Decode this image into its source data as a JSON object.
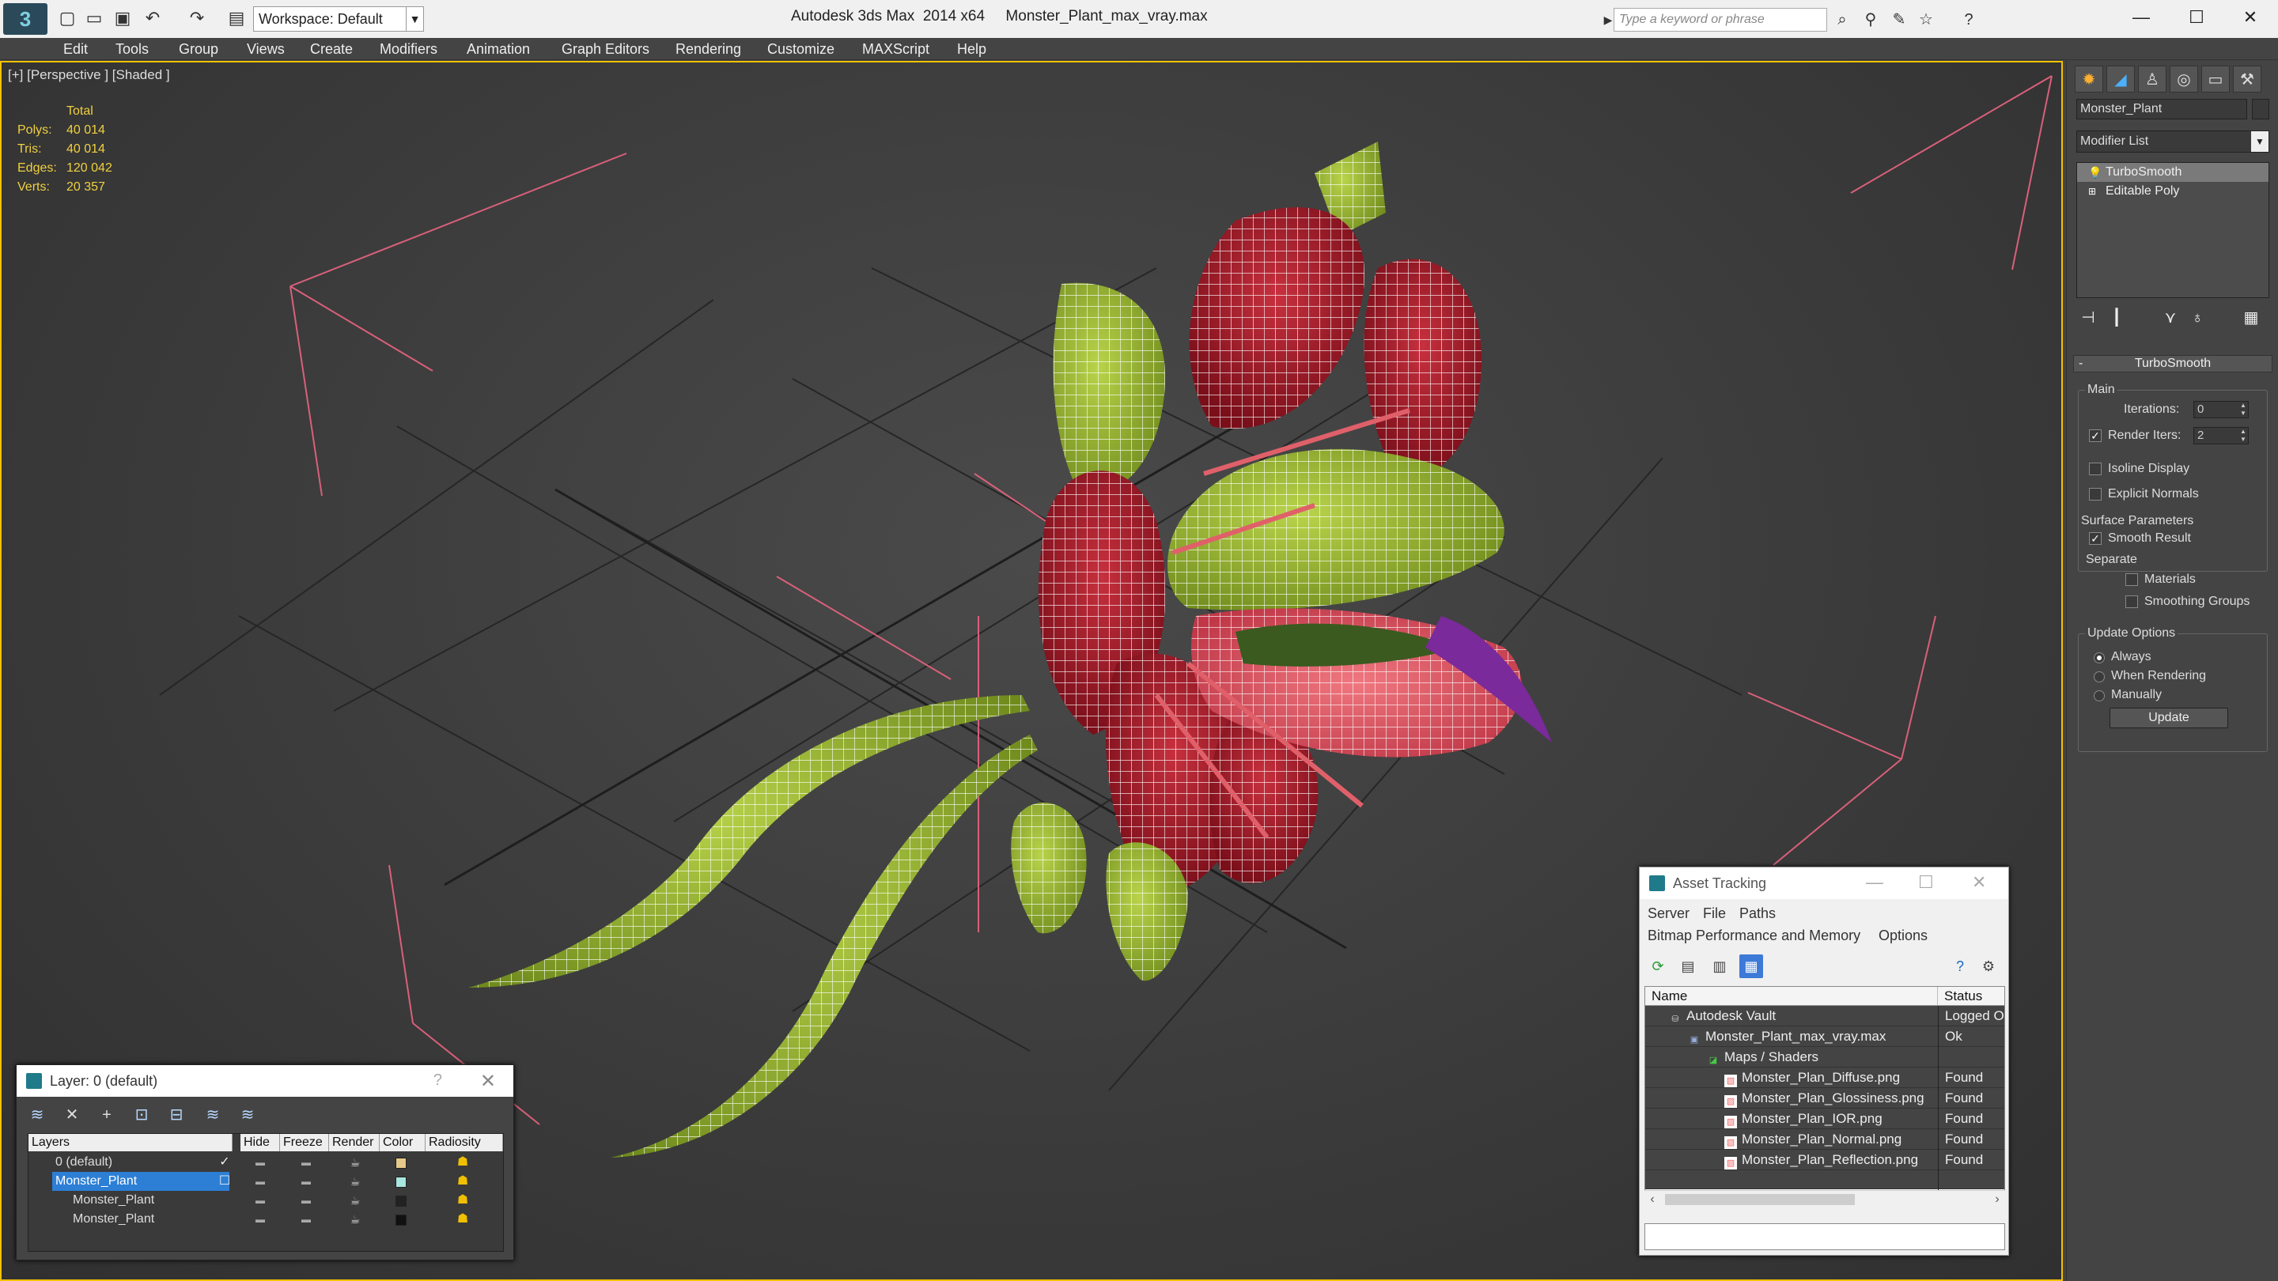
{
  "window": {
    "title": "Autodesk 3ds Max  2014 x64     Monster_Plant_max_vray.max",
    "workspace": "Workspace: Default",
    "search_placeholder": "Type a keyword or phrase"
  },
  "menu": [
    "Edit",
    "Tools",
    "Group",
    "Views",
    "Create",
    "Modifiers",
    "Animation",
    "Graph Editors",
    "Rendering",
    "Customize",
    "MAXScript",
    "Help"
  ],
  "viewport": {
    "label": "[+] [Perspective ] [Shaded ]",
    "stats_header": "Total",
    "stats": [
      {
        "label": "Polys:",
        "value": "40 014"
      },
      {
        "label": "Tris:",
        "value": "40 014"
      },
      {
        "label": "Edges:",
        "value": "120 042"
      },
      {
        "label": "Verts:",
        "value": "20 357"
      }
    ]
  },
  "command_panel": {
    "object_name": "Monster_Plant",
    "modifier_list": "Modifier List",
    "stack": [
      {
        "label": "TurboSmooth",
        "selected": true
      },
      {
        "label": "Editable Poly",
        "selected": false
      }
    ],
    "rollout_title": "TurboSmooth",
    "main_group": "Main",
    "iterations_label": "Iterations:",
    "iterations_value": "0",
    "render_iters_label": "Render Iters:",
    "render_iters_value": "2",
    "render_iters_checked": "✓",
    "isoline_label": "Isoline Display",
    "explicit_normals_label": "Explicit Normals",
    "surface_group": "Surface Parameters",
    "smooth_result_label": "Smooth Result",
    "smooth_result_checked": "✓",
    "separate_label": "Separate",
    "materials_label": "Materials",
    "smoothing_groups_label": "Smoothing Groups",
    "update_group": "Update Options",
    "update_always": "Always",
    "update_rendering": "When Rendering",
    "update_manually": "Manually",
    "update_button": "Update"
  },
  "layer_dialog": {
    "title": "Layer: 0 (default)",
    "help": "?",
    "columns": [
      "Layers",
      "Hide",
      "Freeze",
      "Render",
      "Color",
      "Radiosity"
    ],
    "rows": [
      {
        "name": "0 (default)",
        "check": "✓",
        "color": "#e6c88a"
      },
      {
        "name": "Monster_Plant",
        "check": "",
        "color": "#a8e6e0"
      },
      {
        "name": "Monster_Plant",
        "check": "",
        "color": "#222222"
      },
      {
        "name": "Monster_Plant",
        "check": "",
        "color": "#111111"
      }
    ]
  },
  "asset_dialog": {
    "title": "Asset Tracking",
    "menu_row1": [
      "Server",
      "File",
      "Paths"
    ],
    "menu_row2": [
      "Bitmap Performance and Memory",
      "Options"
    ],
    "columns": [
      "Name",
      "Status"
    ],
    "rows": [
      {
        "name": "Autodesk Vault",
        "status": "Logged O",
        "indent": 0
      },
      {
        "name": "Monster_Plant_max_vray.max",
        "status": "Ok",
        "indent": 1
      },
      {
        "name": "Maps / Shaders",
        "status": "",
        "indent": 2
      },
      {
        "name": "Monster_Plan_Diffuse.png",
        "status": "Found",
        "indent": 3
      },
      {
        "name": "Monster_Plan_Glossiness.png",
        "status": "Found",
        "indent": 3
      },
      {
        "name": "Monster_Plan_IOR.png",
        "status": "Found",
        "indent": 3
      },
      {
        "name": "Monster_Plan_Normal.png",
        "status": "Found",
        "indent": 3
      },
      {
        "name": "Monster_Plan_Reflection.png",
        "status": "Found",
        "indent": 3
      }
    ]
  },
  "colors": {
    "viewport_border": "#f2c200",
    "selection": "#2d7fd6",
    "petal_red": "#b01c2a",
    "leaf_green": "#9ab830"
  }
}
